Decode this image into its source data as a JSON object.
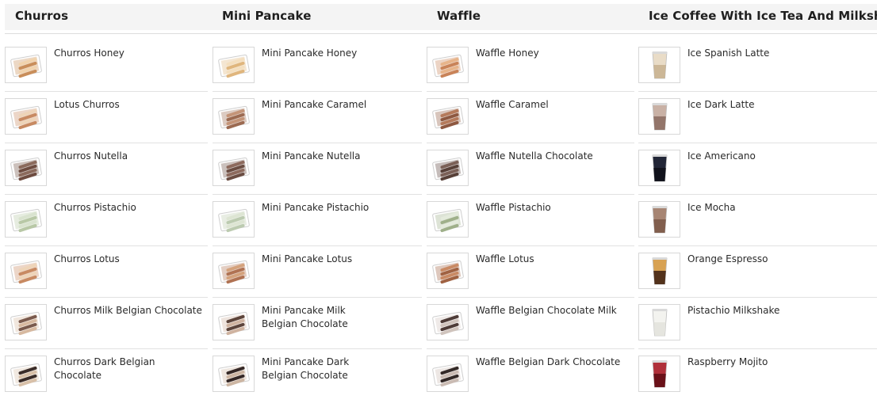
{
  "categories": [
    {
      "title": "Churros",
      "items": [
        {
          "label": "Churros Honey",
          "thumb": "churros-honey-icon"
        },
        {
          "label": "Lotus Churros",
          "thumb": "churros-lotus-icon"
        },
        {
          "label": "Churros Nutella",
          "thumb": "churros-nutella-icon"
        },
        {
          "label": "Churros Pistachio",
          "thumb": "churros-pistachio-icon"
        },
        {
          "label": "Churros Lotus",
          "thumb": "churros-lotus-icon"
        },
        {
          "label": "Churros Milk Belgian Chocolate",
          "thumb": "churros-milk-chocolate-icon"
        },
        {
          "label": "Churros Dark Belgian Chocolate",
          "thumb": "churros-dark-chocolate-icon"
        }
      ]
    },
    {
      "title": "Mini Pancake",
      "items": [
        {
          "label": "Mini Pancake Honey",
          "thumb": "mini-pancake-honey-icon"
        },
        {
          "label": "Mini Pancake Caramel",
          "thumb": "mini-pancake-caramel-icon"
        },
        {
          "label": "Mini Pancake Nutella",
          "thumb": "mini-pancake-nutella-icon"
        },
        {
          "label": "Mini Pancake Pistachio",
          "thumb": "mini-pancake-pistachio-icon"
        },
        {
          "label": "Mini Pancake Lotus",
          "thumb": "mini-pancake-lotus-icon"
        },
        {
          "label": "Mini Pancake Milk Belgian Chocolate",
          "thumb": "mini-pancake-milk-chocolate-icon"
        },
        {
          "label": "Mini Pancake Dark Belgian Chocolate",
          "thumb": "mini-pancake-dark-chocolate-icon"
        }
      ]
    },
    {
      "title": "Waffle",
      "items": [
        {
          "label": "Waffle Honey",
          "thumb": "waffle-honey-icon"
        },
        {
          "label": "Waffle Caramel",
          "thumb": "waffle-caramel-icon"
        },
        {
          "label": "Waffle Nutella Chocolate",
          "thumb": "waffle-nutella-icon"
        },
        {
          "label": "Waffle Pistachio",
          "thumb": "waffle-pistachio-icon"
        },
        {
          "label": "Waffle Lotus",
          "thumb": "waffle-lotus-icon"
        },
        {
          "label": "Waffle Belgian Chocolate Milk",
          "thumb": "waffle-milk-chocolate-icon"
        },
        {
          "label": "Waffle Belgian Dark Chocolate",
          "thumb": "waffle-dark-chocolate-icon"
        }
      ]
    },
    {
      "title": "Ice Coffee With Ice Tea And Milkshake",
      "items": [
        {
          "label": "Ice Spanish Latte",
          "thumb": "iced-latte-cup-icon"
        },
        {
          "label": "Ice Dark Latte",
          "thumb": "iced-dark-latte-cup-icon"
        },
        {
          "label": "Ice Americano",
          "thumb": "iced-americano-cup-icon"
        },
        {
          "label": "Ice Mocha",
          "thumb": "iced-mocha-cup-icon"
        },
        {
          "label": "Orange Espresso",
          "thumb": "orange-espresso-cup-icon"
        },
        {
          "label": "Pistachio Milkshake",
          "thumb": "milkshake-cup-icon"
        },
        {
          "label": "Raspberry Mojito",
          "thumb": "mojito-cup-icon"
        }
      ]
    }
  ],
  "colors": {
    "header_band": "#f4f4f4",
    "divider": "#e2e2e2",
    "honey": "#e9c08e",
    "caramel": "#b98060",
    "nutella": "#7e5a4c",
    "pistachio": "#cfdcc2",
    "lotus": "#c9875e",
    "milk_chocolate": "#5a3f36",
    "dark_chocolate": "#2e2320",
    "latte": "#e6d6bf",
    "dark_latte": "#b49a8c",
    "americano": "#1a1d2a",
    "mocha": "#8e6a58",
    "espresso": "#4a2a18",
    "milkshake": "#eeeeea",
    "mojito": "#7d1620"
  }
}
